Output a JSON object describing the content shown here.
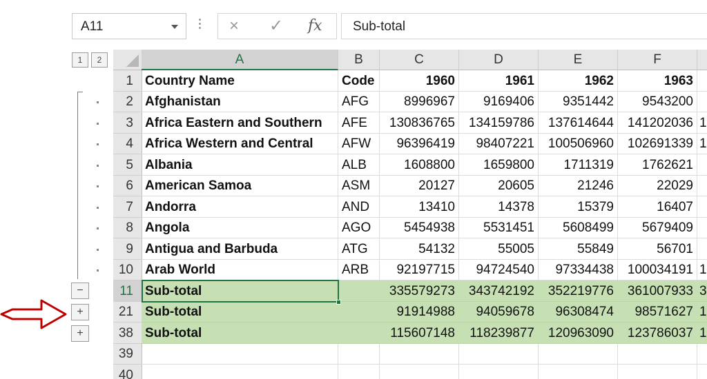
{
  "name_box": {
    "value": "A11"
  },
  "formula_bar": {
    "cancel_icon": "×",
    "enter_icon": "✓",
    "fx_label": "fx",
    "content": "Sub-total"
  },
  "outline": {
    "levels": [
      "1",
      "2"
    ],
    "collapse_symbol": "−",
    "expand_symbol": "+"
  },
  "columns": [
    "A",
    "B",
    "C",
    "D",
    "E",
    "F"
  ],
  "active_column": "A",
  "active_row": "11",
  "colors": {
    "accent": "#217346",
    "subtotal_fill": "#c6e0b4",
    "arrow": "#c00000"
  },
  "rows": [
    {
      "num": "1",
      "cells": [
        "Country Name",
        "Code",
        "1960",
        "1961",
        "1962",
        "1963",
        ""
      ]
    },
    {
      "num": "2",
      "cells": [
        "Afghanistan",
        "AFG",
        "8996967",
        "9169406",
        "9351442",
        "9543200",
        ""
      ]
    },
    {
      "num": "3",
      "cells": [
        "Africa Eastern and Southern",
        "AFE",
        "130836765",
        "134159786",
        "137614644",
        "141202036",
        "1"
      ]
    },
    {
      "num": "4",
      "cells": [
        "Africa Western and Central",
        "AFW",
        "96396419",
        "98407221",
        "100506960",
        "102691339",
        "1"
      ]
    },
    {
      "num": "5",
      "cells": [
        "Albania",
        "ALB",
        "1608800",
        "1659800",
        "1711319",
        "1762621",
        ""
      ]
    },
    {
      "num": "6",
      "cells": [
        "American Samoa",
        "ASM",
        "20127",
        "20605",
        "21246",
        "22029",
        ""
      ]
    },
    {
      "num": "7",
      "cells": [
        "Andorra",
        "AND",
        "13410",
        "14378",
        "15379",
        "16407",
        ""
      ]
    },
    {
      "num": "8",
      "cells": [
        "Angola",
        "AGO",
        "5454938",
        "5531451",
        "5608499",
        "5679409",
        ""
      ]
    },
    {
      "num": "9",
      "cells": [
        "Antigua and Barbuda",
        "ATG",
        "54132",
        "55005",
        "55849",
        "56701",
        ""
      ]
    },
    {
      "num": "10",
      "cells": [
        "Arab World",
        "ARB",
        "92197715",
        "94724540",
        "97334438",
        "100034191",
        "1"
      ]
    },
    {
      "num": "11",
      "cells": [
        "Sub-total",
        "",
        "335579273",
        "343742192",
        "352219776",
        "361007933",
        "3"
      ]
    },
    {
      "num": "21",
      "cells": [
        "Sub-total",
        "",
        "91914988",
        "94059678",
        "96308474",
        "98571627",
        "1"
      ]
    },
    {
      "num": "38",
      "cells": [
        "Sub-total",
        "",
        "115607148",
        "118239877",
        "120963090",
        "123786037",
        "1"
      ]
    },
    {
      "num": "39",
      "cells": [
        "",
        "",
        "",
        "",
        "",
        "",
        ""
      ]
    },
    {
      "num": "40",
      "cells": [
        "",
        "",
        "",
        "",
        "",
        "",
        ""
      ]
    }
  ]
}
